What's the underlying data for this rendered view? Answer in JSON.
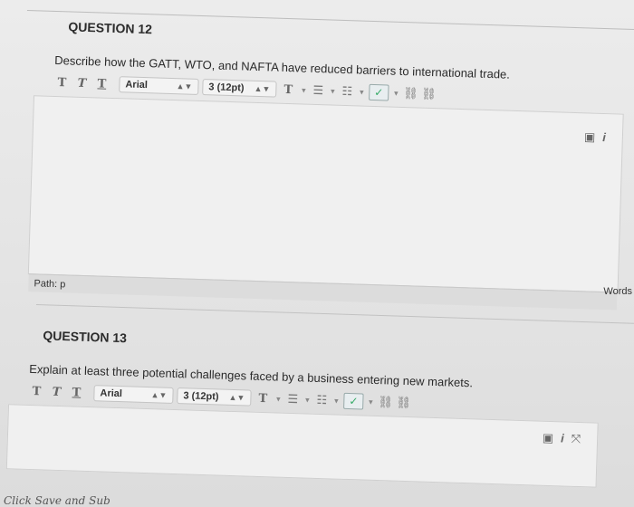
{
  "q12": {
    "header": "QUESTION 12",
    "prompt": "Describe how the GATT, WTO, and NAFTA have reduced barriers to international trade.",
    "font": "Arial",
    "size": "3 (12pt)",
    "path_label": "Path: p"
  },
  "q13": {
    "header": "QUESTION 13",
    "prompt": "Explain at least three potential challenges faced by a business entering new markets.",
    "font": "Arial",
    "size": "3 (12pt)"
  },
  "words_label": "Words",
  "footer_text": "Click Save and Sub",
  "icons": [
    "bold-icon",
    "italic-icon",
    "underline-icon",
    "text-color-icon",
    "bullet-list-icon",
    "numbered-list-icon",
    "spellcheck-icon",
    "link-icon",
    "unlink-icon",
    "preview-icon",
    "info-icon",
    "fullscreen-icon"
  ]
}
